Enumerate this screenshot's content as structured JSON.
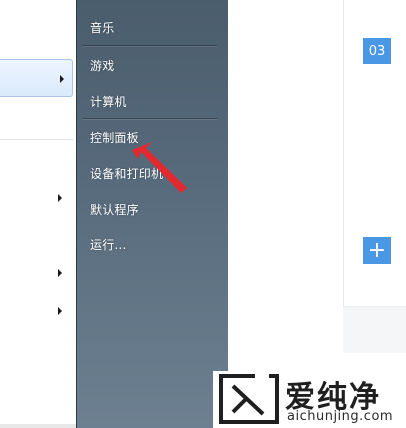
{
  "start_menu": {
    "right_items": [
      {
        "label": "音乐"
      },
      {
        "label": "游戏"
      },
      {
        "label": "计算机"
      },
      {
        "label": "控制面板"
      },
      {
        "label": "设备和打印机"
      },
      {
        "label": "默认程序"
      },
      {
        "label": "运行..."
      }
    ]
  },
  "app": {
    "date_badge": "03",
    "add_label": "+"
  },
  "watermark": {
    "brand": "爱纯净",
    "domain": "aichunjing.com"
  },
  "colors": {
    "pointer": "#e2292f",
    "accent": "#4a97e6"
  }
}
